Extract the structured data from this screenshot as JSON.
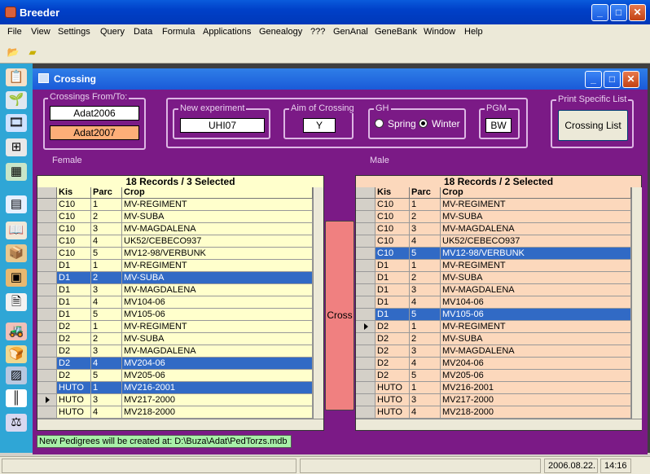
{
  "app": {
    "title": "Breeder"
  },
  "menu": [
    "File",
    "View",
    "Settings",
    "Query",
    "Data",
    "Formula",
    "Applications",
    "Genealogy",
    "???",
    "GenAnal",
    "GeneBank",
    "Window",
    "Help"
  ],
  "window": {
    "title": "Crossing"
  },
  "crossings": {
    "label": "Crossings From/To:",
    "from": "Adat2006",
    "to": "Adat2007"
  },
  "new_experiment": {
    "label": "New experiment",
    "value": "UHI07"
  },
  "aim": {
    "label": "Aim of Crossing",
    "value": "Y"
  },
  "gh": {
    "label": "GH",
    "spring": "Spring",
    "winter": "Winter",
    "selected": "Winter"
  },
  "pgm": {
    "label": "PGM",
    "value": "BW"
  },
  "print": {
    "label": "Print Specific List",
    "button": "Crossing List"
  },
  "female": {
    "label": "Female",
    "header": "18 Records / 3 Selected"
  },
  "male": {
    "label": "Male",
    "header": "18 Records / 2 Selected"
  },
  "columns": [
    "Kis",
    "Parc",
    "Crop"
  ],
  "rows": [
    [
      "C10",
      "1",
      "MV-REGIMENT"
    ],
    [
      "C10",
      "2",
      "MV-SUBA"
    ],
    [
      "C10",
      "3",
      "MV-MAGDALENA"
    ],
    [
      "C10",
      "4",
      "UK52/CEBECO937"
    ],
    [
      "C10",
      "5",
      "MV12-98/VERBUNK"
    ],
    [
      "D1",
      "1",
      "MV-REGIMENT"
    ],
    [
      "D1",
      "2",
      "MV-SUBA"
    ],
    [
      "D1",
      "3",
      "MV-MAGDALENA"
    ],
    [
      "D1",
      "4",
      "MV104-06"
    ],
    [
      "D1",
      "5",
      "MV105-06"
    ],
    [
      "D2",
      "1",
      "MV-REGIMENT"
    ],
    [
      "D2",
      "2",
      "MV-SUBA"
    ],
    [
      "D2",
      "3",
      "MV-MAGDALENA"
    ],
    [
      "D2",
      "4",
      "MV204-06"
    ],
    [
      "D2",
      "5",
      "MV205-06"
    ],
    [
      "HUTO",
      "1",
      "MV216-2001"
    ],
    [
      "HUTO",
      "3",
      "MV217-2000"
    ],
    [
      "HUTO",
      "4",
      "MV218-2000"
    ]
  ],
  "female_selected": [
    6,
    13,
    15
  ],
  "female_current": 16,
  "male_selected": [
    4,
    9
  ],
  "male_current": 10,
  "cross_button": "Cross",
  "status_message": "New Pedigrees will be created at: D:\\Buza\\Adat\\PedTorzs.mdb",
  "statusbar": {
    "date": "2006.08.22.",
    "time": "14:16"
  },
  "colors": {
    "purple": "#7b1a86",
    "female_row": "#ffffcc",
    "male_row": "#fcd8bc",
    "selected": "#316ac5",
    "cross": "#f08080"
  }
}
